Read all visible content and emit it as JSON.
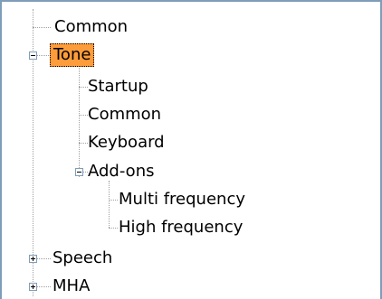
{
  "tree": {
    "items": [
      {
        "label": "Common",
        "level": 1,
        "expander": "none",
        "selected": false
      },
      {
        "label": "Tone",
        "level": 1,
        "expander": "minus",
        "selected": true
      },
      {
        "label": "Startup",
        "level": 2,
        "expander": "none",
        "selected": false
      },
      {
        "label": "Common",
        "level": 2,
        "expander": "none",
        "selected": false
      },
      {
        "label": "Keyboard",
        "level": 2,
        "expander": "none",
        "selected": false
      },
      {
        "label": "Add-ons",
        "level": 2,
        "expander": "minus",
        "selected": false
      },
      {
        "label": "Multi frequency",
        "level": 3,
        "expander": "none",
        "selected": false
      },
      {
        "label": "High frequency",
        "level": 3,
        "expander": "none",
        "selected": false
      },
      {
        "label": "Speech",
        "level": 1,
        "expander": "plus",
        "selected": false
      },
      {
        "label": "MHA",
        "level": 1,
        "expander": "plus",
        "selected": false
      }
    ]
  },
  "colors": {
    "selection": "#fd9c3a",
    "border": "#7f9db9",
    "connector": "#a0a0a0"
  },
  "icons": [
    "expand-plus-icon",
    "collapse-minus-icon"
  ]
}
